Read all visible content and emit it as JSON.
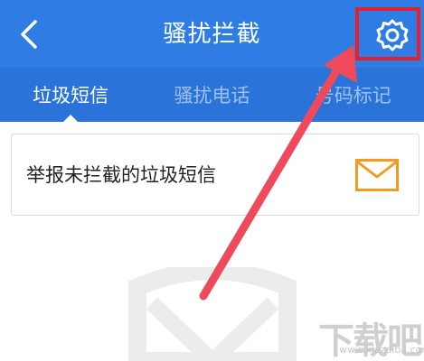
{
  "header": {
    "title": "骚扰拦截",
    "back_icon": "chevron-left-icon",
    "settings_icon": "gear-icon",
    "background": "#2f7de4"
  },
  "tabs": [
    {
      "label": "垃圾短信",
      "active": true
    },
    {
      "label": "骚扰电话",
      "active": false
    },
    {
      "label": "号码标记",
      "active": false
    }
  ],
  "card": {
    "label": "举报未拦截的垃圾短信",
    "icon": "mail-icon",
    "icon_color": "#f29b1f"
  },
  "watermark": {
    "text": "下载吧",
    "sub": "www.xiazaiba.com"
  },
  "annotation": {
    "highlight_color": "#e3202b",
    "arrow_color": "#ef4a5b"
  }
}
